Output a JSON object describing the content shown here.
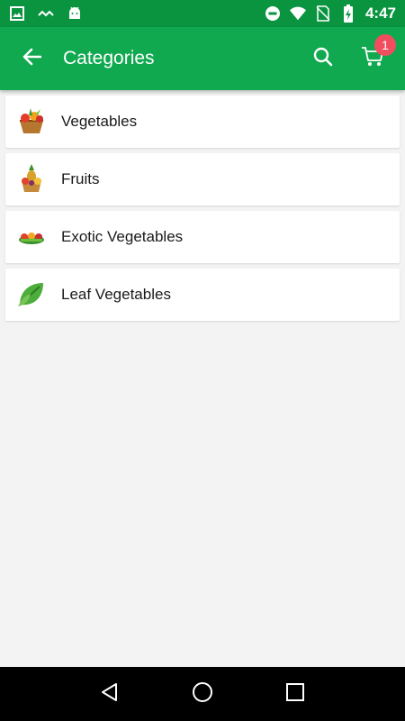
{
  "status_bar": {
    "time": "4:47",
    "icons_left": [
      "image-icon",
      "swap-icon",
      "android-icon"
    ],
    "icons_right": [
      "do-not-disturb-icon",
      "wifi-icon",
      "no-sim-icon",
      "battery-charging-icon"
    ]
  },
  "app_bar": {
    "title": "Categories",
    "back_icon": "arrow-left-icon",
    "search_icon": "search-icon",
    "cart_icon": "cart-icon",
    "cart_count": "1",
    "color": "#10a950",
    "badge_color": "#f04e5e"
  },
  "categories": [
    {
      "label": "Vegetables",
      "icon": "vegetable-basket-icon"
    },
    {
      "label": "Fruits",
      "icon": "fruit-basket-icon"
    },
    {
      "label": "Exotic Vegetables",
      "icon": "exotic-vegetables-icon"
    },
    {
      "label": "Leaf Vegetables",
      "icon": "leaf-vegetables-icon"
    }
  ],
  "nav_bar": {
    "back": "nav-back-icon",
    "home": "nav-home-icon",
    "recents": "nav-recents-icon"
  }
}
